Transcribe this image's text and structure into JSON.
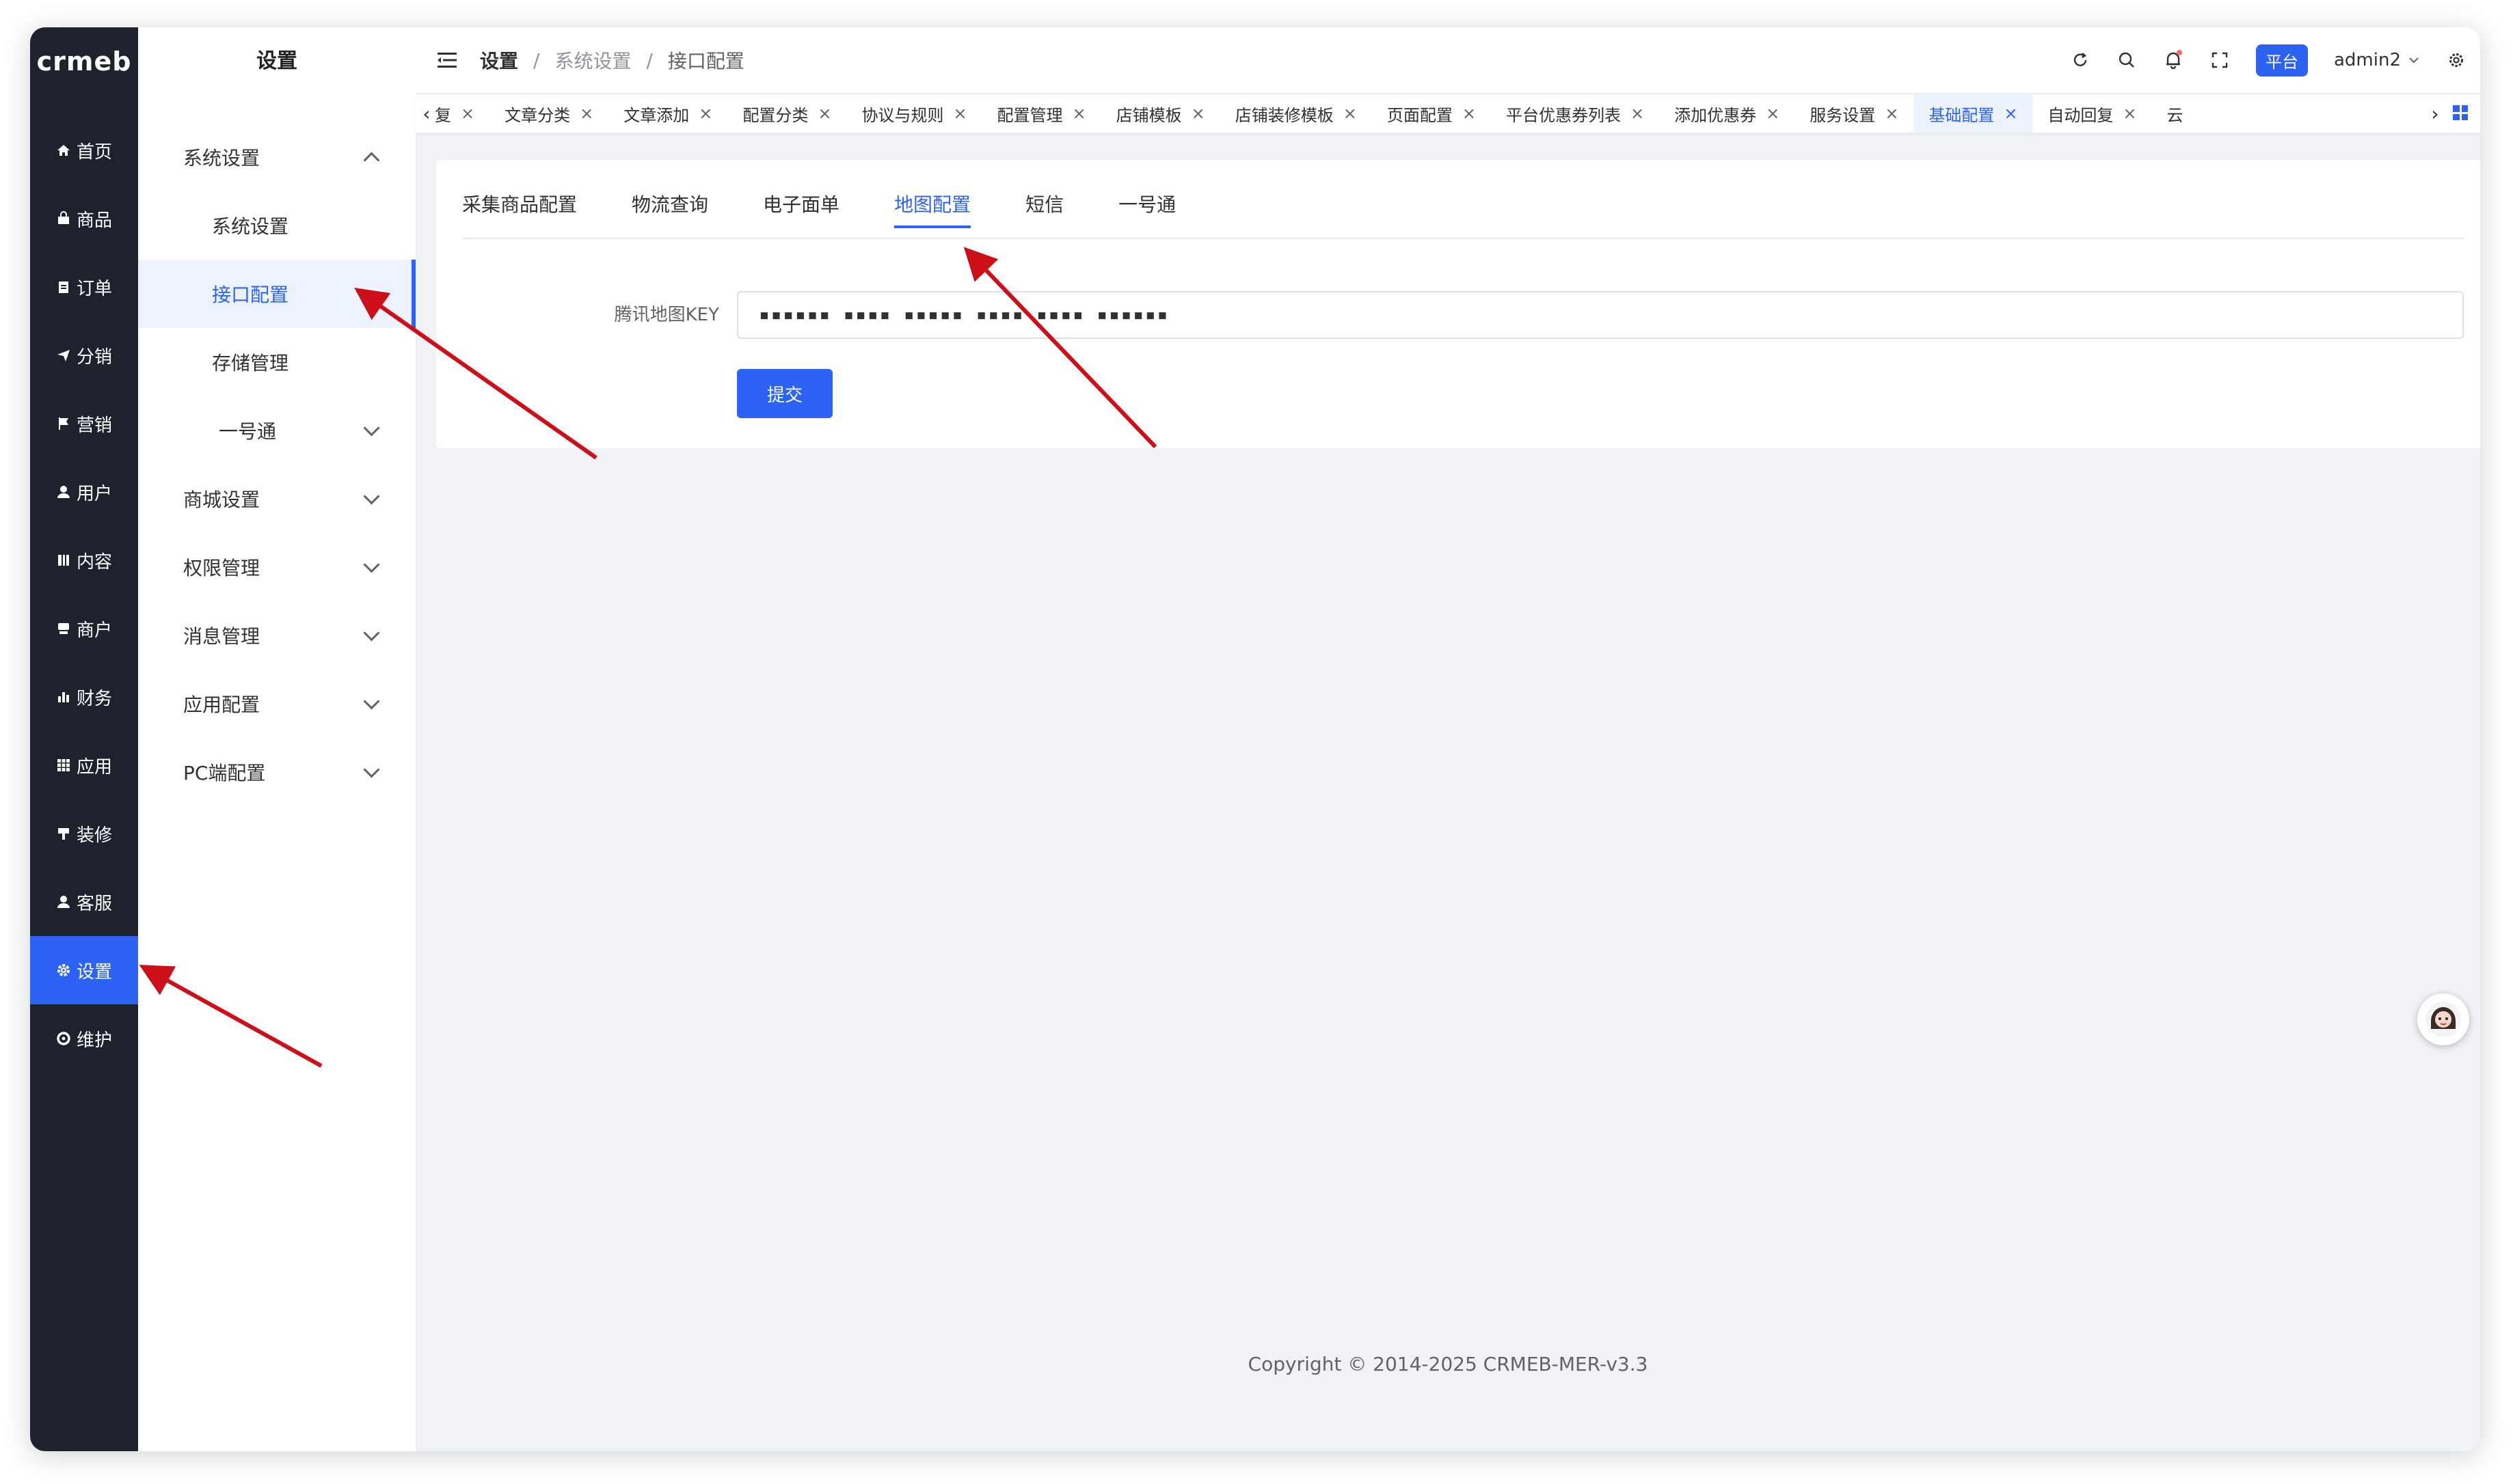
{
  "logo": {
    "text": "crmeb"
  },
  "rail": {
    "items": [
      {
        "label": "首页",
        "icon": "home-icon"
      },
      {
        "label": "商品",
        "icon": "shop-icon"
      },
      {
        "label": "订单",
        "icon": "clipboard-icon"
      },
      {
        "label": "分销",
        "icon": "send-icon"
      },
      {
        "label": "营销",
        "icon": "flag-icon"
      },
      {
        "label": "用户",
        "icon": "user-icon"
      },
      {
        "label": "内容",
        "icon": "book-icon"
      },
      {
        "label": "商户",
        "icon": "store-icon"
      },
      {
        "label": "财务",
        "icon": "bar-chart-icon"
      },
      {
        "label": "应用",
        "icon": "apps-icon"
      },
      {
        "label": "装修",
        "icon": "brush-icon"
      },
      {
        "label": "客服",
        "icon": "support-icon"
      },
      {
        "label": "设置",
        "icon": "gear-icon"
      },
      {
        "label": "维护",
        "icon": "tools-icon"
      }
    ],
    "active_index": 12
  },
  "subside": {
    "title": "设置",
    "items": [
      {
        "label": "系统设置"
      },
      {
        "label": "系统设置"
      },
      {
        "label": "接口配置"
      },
      {
        "label": "存储管理"
      },
      {
        "label": "一号通"
      },
      {
        "label": "商城设置"
      },
      {
        "label": "权限管理"
      },
      {
        "label": "消息管理"
      },
      {
        "label": "应用配置"
      },
      {
        "label": "PC端配置"
      }
    ]
  },
  "header": {
    "breadcrumb": [
      "设置",
      "系统设置",
      "接口配置"
    ],
    "separator": "/",
    "platform_label": "平台",
    "username": "admin2"
  },
  "tabs": {
    "items": [
      "复",
      "文章分类",
      "文章添加",
      "配置分类",
      "协议与规则",
      "配置管理",
      "店铺模板",
      "店铺装修模板",
      "页面配置",
      "平台优惠券列表",
      "添加优惠券",
      "服务设置",
      "基础配置",
      "自动回复",
      "云"
    ],
    "active_index": 12,
    "close_glyph": "×"
  },
  "content_tabs": {
    "items": [
      "采集商品配置",
      "物流查询",
      "电子面单",
      "地图配置",
      "短信",
      "一号通"
    ],
    "active_index": 3
  },
  "form": {
    "label": "腾讯地图KEY",
    "value": "▪▪▪▪▪▪ ▪▪▪▪ ▪▪▪▪▪ ▪▪▪▪ ▪▪▪▪ ▪▪▪▪▪▪",
    "submit_label": "提交"
  },
  "footer": {
    "copyright": "Copyright © 2014-2025 CRMEB-MER-v3.3"
  },
  "colors": {
    "primary": "#2d63f5",
    "rail_bg": "#1e222d",
    "annotation_arrow": "#cc0f19"
  }
}
